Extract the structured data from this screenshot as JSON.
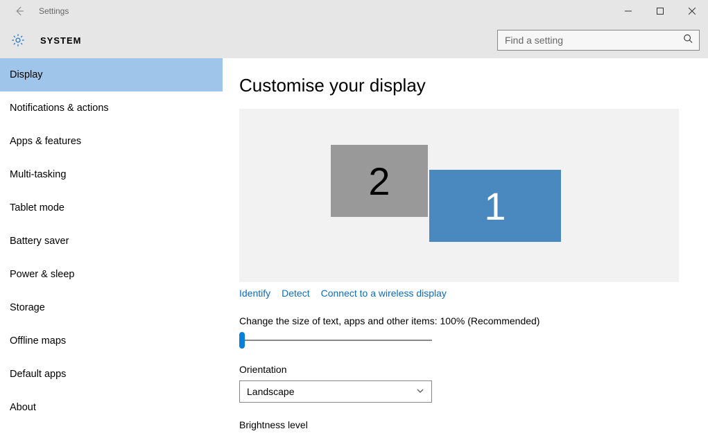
{
  "window": {
    "app_title": "Settings"
  },
  "header": {
    "title": "SYSTEM",
    "search_placeholder": "Find a setting"
  },
  "sidebar": {
    "items": [
      {
        "label": "Display",
        "selected": true
      },
      {
        "label": "Notifications & actions",
        "selected": false
      },
      {
        "label": "Apps & features",
        "selected": false
      },
      {
        "label": "Multi-tasking",
        "selected": false
      },
      {
        "label": "Tablet mode",
        "selected": false
      },
      {
        "label": "Battery saver",
        "selected": false
      },
      {
        "label": "Power & sleep",
        "selected": false
      },
      {
        "label": "Storage",
        "selected": false
      },
      {
        "label": "Offline maps",
        "selected": false
      },
      {
        "label": "Default apps",
        "selected": false
      },
      {
        "label": "About",
        "selected": false
      }
    ]
  },
  "main": {
    "heading": "Customise your display",
    "monitors": {
      "primary_label": "1",
      "secondary_label": "2"
    },
    "links": {
      "identify": "Identify",
      "detect": "Detect",
      "connect": "Connect to a wireless display"
    },
    "scale_label": "Change the size of text, apps and other items: 100% (Recommended)",
    "orientation_label": "Orientation",
    "orientation_value": "Landscape",
    "brightness_label": "Brightness level"
  }
}
